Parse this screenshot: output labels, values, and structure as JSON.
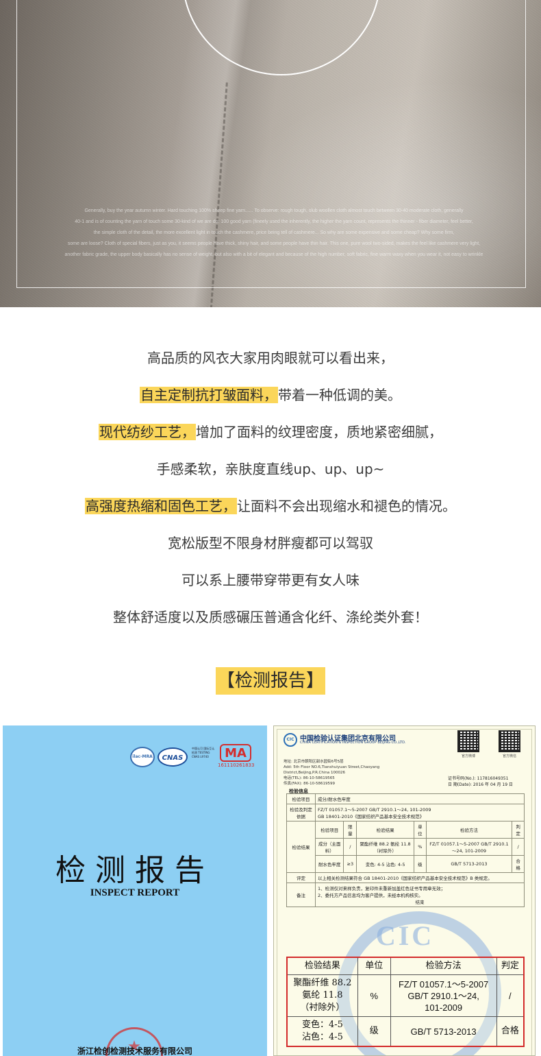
{
  "photo": {
    "caption_lines": [
      "Generally, buy the year autumn winter. Hard touching 100% sheep fine yarn...... To observe: rough tough, slub woollen cloth almost touch between 30-40 moderate cloth, generally",
      "40-1 and is of counting the yarn of touch some 30-kind of we are do: 100 good yarn (fineely used the inherently, the higher the yarn count, represents the thinner - fiber diameter, feel better,",
      "the simple cloth of the detail, the more excellent light in touch the cashmere, price being tell of cashmere... So why are some expensive and some cheap? Why some firm,",
      "some are loose? Cloth of special fibers, just as you, it seems people have thick, shiny hair, and some people have thin hair. This one, pure wool two-sided, makes the feel like cashmere very light,",
      "another fabric grade, the upper body basically has no sense of weight, but also with a bit of elegant and because of the high number, soft fabric, fine warm waxy when you wear it, not easy to wrinkle"
    ]
  },
  "text_lines": [
    {
      "highlight": "",
      "rest": "高品质的风衣大家用肉眼就可以看出来，"
    },
    {
      "highlight": "自主定制抗打皱面料，",
      "rest": "带着一种低调的美。"
    },
    {
      "highlight": "现代纺纱工艺，",
      "rest": "增加了面料的纹理密度，质地紧密细腻，"
    },
    {
      "highlight": "",
      "rest": "手感柔软，亲肤度直线up、up、up~"
    },
    {
      "highlight": "高强度热缩和固色工艺，",
      "rest": "让面料不会出现缩水和褪色的情况。"
    },
    {
      "highlight": "",
      "rest": "宽松版型不限身材胖瘦都可以驾驭"
    },
    {
      "highlight": "",
      "rest": "可以系上腰带穿带更有女人味"
    },
    {
      "highlight": "",
      "rest": "整体舒适度以及质感碾压普通含化纤、涤纶类外套！"
    }
  ],
  "section_title": "【检测报告】",
  "cover": {
    "logo_ilac": "ilac-MRA",
    "logo_cnas": "CNAS",
    "logo_small_text": "中国认可 国际互认 检测 TESTING CNAS L9740",
    "logo_cma": "MA",
    "cma_number": "161110261833",
    "title": "检测报告",
    "subtitle": "INSPECT REPORT",
    "company": "浙江检创检测技术服务有限公司"
  },
  "certificate": {
    "org_cn": "中国检验认证集团北京有限公司",
    "org_en": "CHINA CERTIFICATION & INSPECTION GROUP BEIJING CO.,LTD.",
    "logo_text": "CIC",
    "qr1_label": "官方微博",
    "qr2_label": "官方微信",
    "address_lines": [
      "地址: 北京市朝阳区甜水园街6号5层",
      "Add:  5th Floor NO.6,Tianshuiyuan Street,Chaoyang",
      "          District,Beijing,P.R.China   100026",
      "电话(TEL):   86-10-58619565",
      "传真(FAX):   86-10-58619599"
    ],
    "cert_no": "证书号码(No.): 117816049351",
    "date": "日    期(Date): 2016 年 04 月 19 日",
    "section": "检验信息",
    "rows": {
      "item_label": "检验项目",
      "item_value": "成分/耐水色牢度",
      "basis_label": "检验及判定依据",
      "basis_value1": "FZ/T 01057.1～5-2007        GB/T 2910.1～24,      101-2009",
      "basis_value2": "GB 18401-2010《国家纺织产品基本安全技术规范》",
      "result_label": "检验结果",
      "headers": [
        "检验项目",
        "限量",
        "检验结果",
        "单位",
        "检验方法",
        "判定"
      ],
      "r1": [
        "成分（主面料）",
        "/",
        "聚酯纤维 88.2 氨纶 11.8 （衬除外）",
        "%",
        "FZ/T 01057.1～5-2007 GB/T 2910.1～24, 101-2009",
        "/"
      ],
      "r2": [
        "耐水色牢度",
        "≥3",
        "变色: 4-5 沾色: 4-5",
        "级",
        "GB/T 5713-2013",
        "合格"
      ],
      "eval_label": "评定",
      "eval_value": "以上相关检测结果符合 GB 18401-2010《国家纺织产品基本安全技术规范》B 类规定。",
      "note_label": "备注",
      "note_value1": "1、检测仅对来样负责，复印件未重新加盖红色证书专用章无效；",
      "note_value2": "2、委托方产品信息均为客户提供，未经本机构核实。",
      "end": "结束"
    },
    "watermark": "CIC",
    "zoom": {
      "headers": [
        "检验结果",
        "单位",
        "检验方法",
        "判定"
      ],
      "row1": {
        "result": [
          "聚酯纤维 88.2",
          "氨纶 11.8",
          "（衬除外）"
        ],
        "unit": "%",
        "method": [
          "FZ/T 01057.1～5-2007",
          "GB/T 2910.1～24,",
          "101-2009"
        ],
        "verdict": "/"
      },
      "row2": {
        "result": [
          "变色：4-5",
          "沾色：4-5"
        ],
        "unit": "级",
        "method": "GB/T 5713-2013",
        "verdict": "合格"
      }
    }
  },
  "colors": {
    "highlight": "#fbd65a",
    "cover_blue": "#8dcff3",
    "frame_red": "#d32a2a"
  }
}
